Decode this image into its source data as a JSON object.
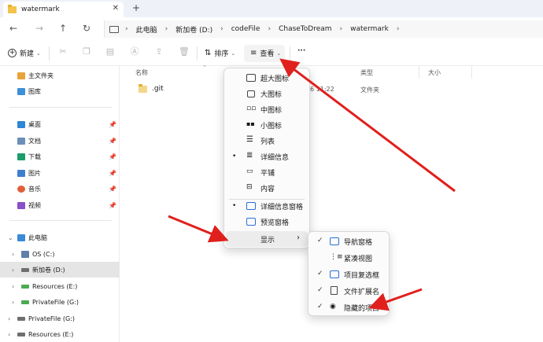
{
  "titlebar": {
    "tab_title": "watermark",
    "close_glyph": "✕",
    "add_glyph": "+"
  },
  "nav": {
    "back": "←",
    "forward": "→",
    "up": "↑",
    "refresh": "↻",
    "breadcrumbs": [
      "此电脑",
      "新加卷 (D:)",
      "codeFile",
      "ChaseToDream",
      "watermark"
    ],
    "sep": "›"
  },
  "toolbar": {
    "new_label": "新建",
    "sort_label": "排序",
    "view_label": "查看",
    "more_label": "···"
  },
  "sidebar": {
    "home": "主文件夹",
    "gallery": "图库",
    "quick": [
      {
        "label": "桌面"
      },
      {
        "label": "文档"
      },
      {
        "label": "下载"
      },
      {
        "label": "图片"
      },
      {
        "label": "音乐"
      },
      {
        "label": "视频"
      }
    ],
    "this_pc": "此电脑",
    "drives": [
      {
        "label": "OS (C:)"
      },
      {
        "label": "新加卷 (D:)"
      },
      {
        "label": "Resources (E:)"
      },
      {
        "label": "PrivateFile (G:)"
      }
    ],
    "network_drives": [
      {
        "label": "PrivateFile (G:)"
      },
      {
        "label": "Resources (E:)"
      }
    ]
  },
  "content": {
    "headers": {
      "name": "名称",
      "type": "类型",
      "size": "大小"
    },
    "files": [
      {
        "name": ".git",
        "date_fragment": "6 11:22",
        "type": "文件夹"
      }
    ]
  },
  "view_menu": {
    "items": [
      "超大图标",
      "大图标",
      "中图标",
      "小图标",
      "列表",
      "详细信息",
      "平铺",
      "内容"
    ],
    "pane_items": [
      "详细信息窗格",
      "预览窗格"
    ],
    "show_label": "显示",
    "bullet": "•",
    "submenu_arrow": "›"
  },
  "show_menu": {
    "items": [
      {
        "label": "导航窗格",
        "checked": true
      },
      {
        "label": "紧凑视图",
        "checked": false
      },
      {
        "label": "项目复选框",
        "checked": true
      },
      {
        "label": "文件扩展名",
        "checked": true
      },
      {
        "label": "隐藏的项目",
        "checked": true
      }
    ],
    "check": "✓"
  },
  "colors": {
    "arrow": "#e0201c",
    "folder": "#f3c34a",
    "accent": "#2b6fd6"
  }
}
